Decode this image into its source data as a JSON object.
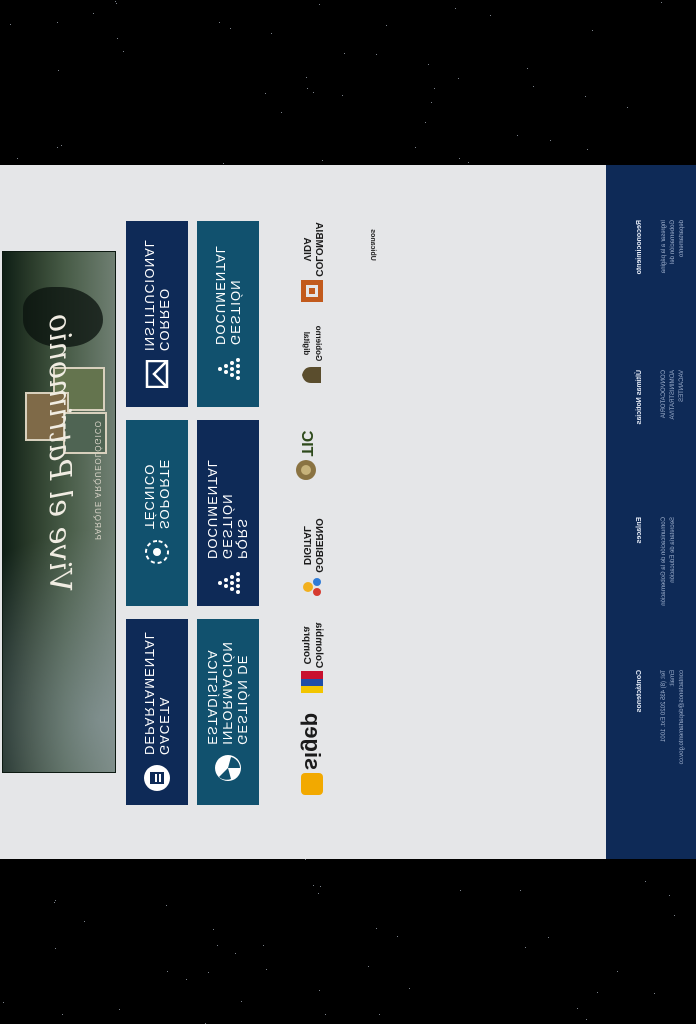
{
  "banner": {
    "title": "Vive el Patrimonio",
    "subtitle": "PARQUE ARQUEOLÓGICO"
  },
  "tiles": [
    {
      "label": "GESTIÓN\nDOCUMENTAL",
      "icon": "documents-icon"
    },
    {
      "label": "CORREO\nINSTITUCIONAL",
      "icon": "envelope-icon"
    },
    {
      "label": "PQRS\nGESTIÓN DOCUMENTAL",
      "icon": "documents-icon"
    },
    {
      "label": "SOPORTE\nTÉCNICO",
      "icon": "support-icon"
    },
    {
      "label": "GESTIÓN DE\nINFORMACIÓN\nESTADÍSTICA",
      "icon": "statistics-icon"
    },
    {
      "label": "GACETA\nDEPARTAMENTAL",
      "icon": "gazette-icon"
    }
  ],
  "logos": [
    {
      "text": "COLOMBIA\nVIDA",
      "icon": "colombia-vida-logo"
    },
    {
      "text": "Gobierno\ndigital",
      "icon": "coat-of-arms-logo"
    },
    {
      "text": "TIC",
      "icon": "tic-logo"
    },
    {
      "text": "GOBIERNO\nDIGITAL",
      "icon": "gobierno-digital-logo"
    },
    {
      "text": "Colombia\nCompra",
      "icon": "colombia-compra-logo"
    },
    {
      "text": "sigep",
      "icon": "sigep-logo"
    }
  ],
  "section_tag": "Ubicanos",
  "footer": {
    "columns": [
      {
        "heading": "Reconocimiento",
        "lines": [
          "Ingresar a la página",
          "Gobernación del",
          "departamento"
        ]
      },
      {
        "heading": "Últimas Noticias",
        "lines": [
          "CONVOCATORIA",
          "ADMINISTRATIVA",
          "VACANTES"
        ]
      },
      {
        "heading": "Enlaces",
        "lines": [
          "Comunicación de la Gobernación",
          "Secretaría de Educación"
        ]
      },
      {
        "heading": "Contáctenos",
        "lines": [
          "Tel: (8) 435 2020 Ext. 1001",
          "Email:",
          "contactenos@departamento.gov.co"
        ]
      }
    ]
  },
  "colors": {
    "background": "#000000",
    "page": "#e5e6e8",
    "tile_dark": "#0e2a57",
    "tile_teal": "#11516e",
    "footer": "#0e2a57"
  }
}
